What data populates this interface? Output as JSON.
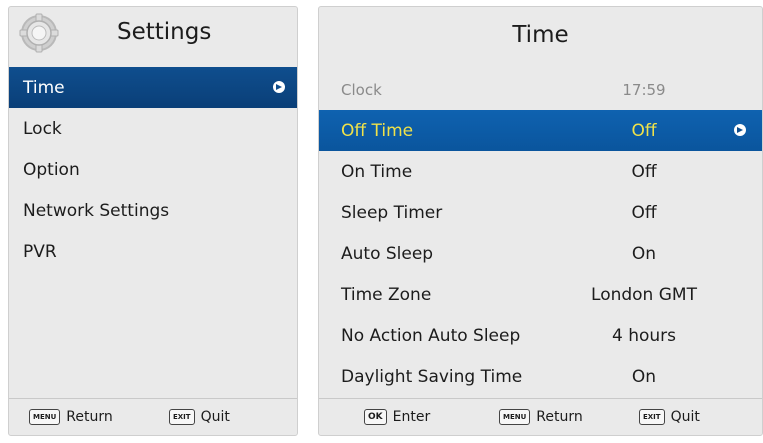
{
  "settings_panel": {
    "title": "Settings",
    "items": [
      {
        "label": "Time"
      },
      {
        "label": "Lock"
      },
      {
        "label": "Option"
      },
      {
        "label": "Network Settings"
      },
      {
        "label": "PVR"
      }
    ],
    "footer": {
      "menu_key": "MENU",
      "return_label": "Return",
      "exit_key": "EXIT",
      "quit_label": "Quit"
    }
  },
  "time_panel": {
    "title": "Time",
    "clock": {
      "label": "Clock",
      "value": "17:59"
    },
    "rows": [
      {
        "label": "Off Time",
        "value": "Off"
      },
      {
        "label": "On Time",
        "value": "Off"
      },
      {
        "label": "Sleep Timer",
        "value": "Off"
      },
      {
        "label": "Auto Sleep",
        "value": "On"
      },
      {
        "label": "Time Zone",
        "value": "London GMT"
      },
      {
        "label": "No Action Auto Sleep",
        "value": "4 hours"
      },
      {
        "label": "Daylight Saving Time",
        "value": "On"
      }
    ],
    "footer": {
      "ok_key": "OK",
      "enter_label": "Enter",
      "menu_key": "MENU",
      "return_label": "Return",
      "exit_key": "EXIT",
      "quit_label": "Quit"
    }
  },
  "colors": {
    "selection_left": "#0f4e8e",
    "selection_right": "#0f62b0",
    "selected_value_text": "#f0e24a",
    "panel_bg": "#eaeaea"
  },
  "icons": {
    "header_icon": "gear-icon",
    "selection_arrow": "arrow-right-circle-icon"
  }
}
